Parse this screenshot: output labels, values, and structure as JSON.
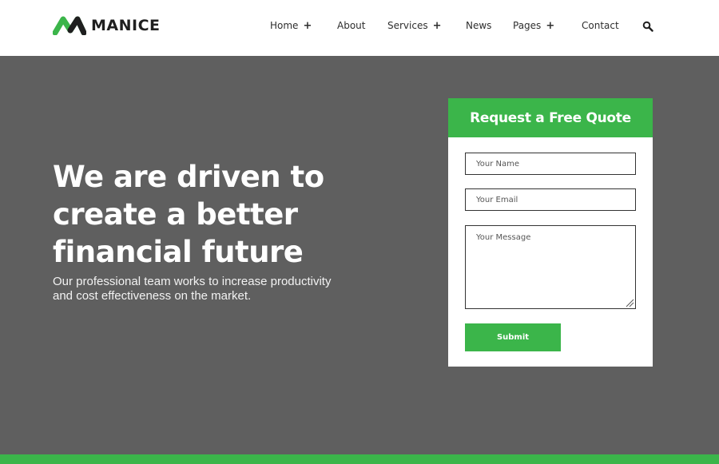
{
  "brand": {
    "name": "MANICE",
    "accent": "#3bb54a"
  },
  "nav": {
    "items": [
      {
        "label": "Home",
        "has_submenu": true
      },
      {
        "label": "About",
        "has_submenu": false
      },
      {
        "label": "Services",
        "has_submenu": true
      },
      {
        "label": "News",
        "has_submenu": false
      },
      {
        "label": "Pages",
        "has_submenu": true
      },
      {
        "label": "Contact",
        "has_submenu": false
      }
    ],
    "submenu_marker": "+",
    "search_icon": "search-icon"
  },
  "hero": {
    "title_lines": [
      "We are driven to",
      "create a better",
      "financial future"
    ],
    "subtitle_lines": [
      "Our professional team works to increase productivity",
      "and cost effectiveness on the market."
    ]
  },
  "quote_form": {
    "title": "Request a Free Quote",
    "name_placeholder": "Your Name",
    "email_placeholder": "Your Email",
    "message_placeholder": "Your Message",
    "submit_label": "Submit"
  }
}
